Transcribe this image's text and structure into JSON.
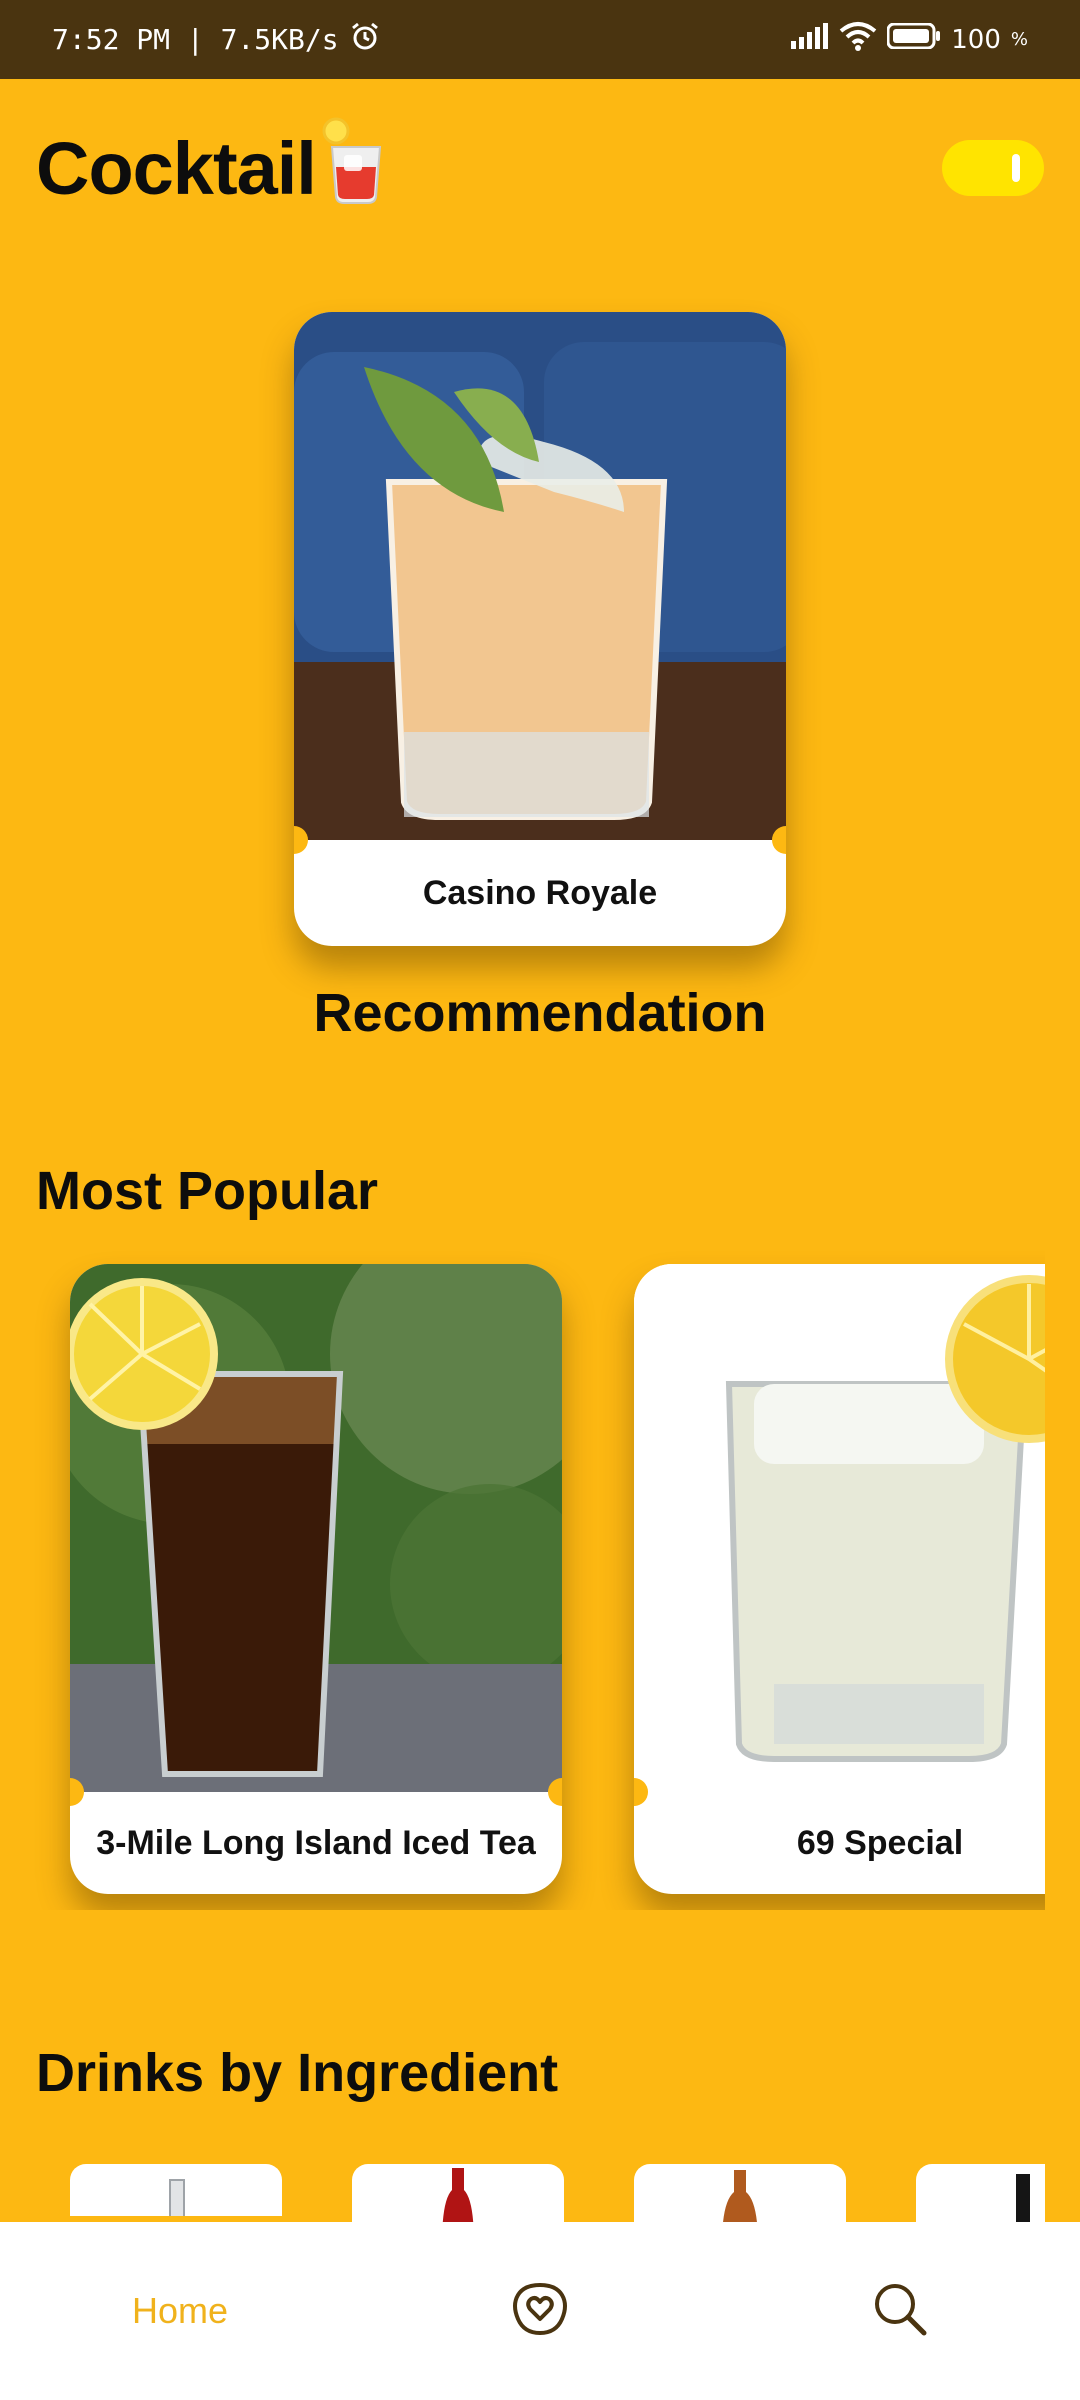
{
  "status_bar": {
    "time_speed": "7:52 PM | 7.5KB/s",
    "battery": "100"
  },
  "header": {
    "title": "Cocktail",
    "theme_toggle_on": true
  },
  "recommendation": {
    "card_name": "Casino Royale",
    "label": "Recommendation"
  },
  "most_popular": {
    "title": "Most Popular",
    "items": [
      {
        "name": "3-Mile Long Island Iced Tea"
      },
      {
        "name": "69 Special"
      }
    ]
  },
  "ingredients": {
    "title": "Drinks by Ingredient"
  },
  "bottom_nav": {
    "home_label": "Home",
    "favorites_icon": "heart-badge-icon",
    "search_icon": "search-icon"
  },
  "colors": {
    "background": "#FDB812",
    "status_bar": "#4A3410",
    "toggle": "#FFE400",
    "active_nav": "#F0B21C"
  }
}
